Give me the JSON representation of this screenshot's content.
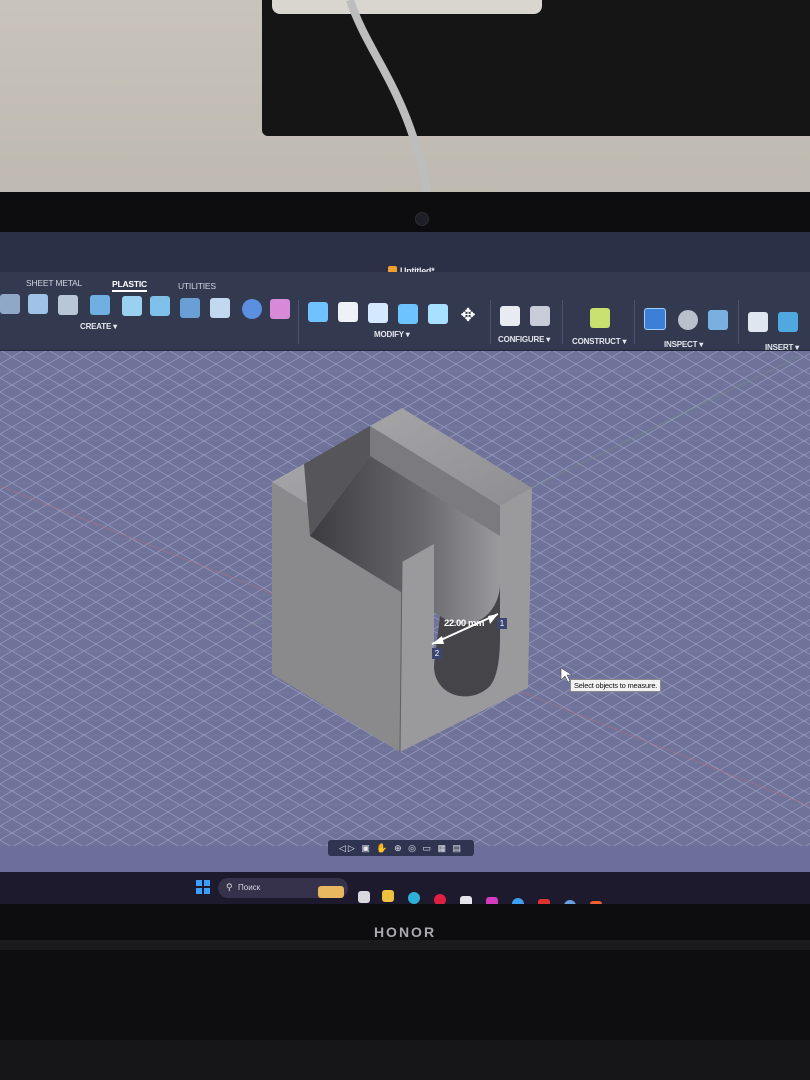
{
  "app": {
    "document_title": "Untitled*"
  },
  "tabs": [
    {
      "label": "SHEET METAL"
    },
    {
      "label": "PLASTIC"
    },
    {
      "label": "UTILITIES"
    }
  ],
  "groups": {
    "create": "CREATE ▾",
    "modify": "MODIFY ▾",
    "configure": "CONFIGURE ▾",
    "construct": "CONSTRUCT ▾",
    "inspect": "INSPECT ▾",
    "insert": "INSERT ▾"
  },
  "measurement": {
    "value": "22.00 mm",
    "point_1": "1",
    "point_2": "2",
    "tooltip": "Select objects to measure."
  },
  "navbar": {
    "icons": "◁▷ ▣ ✋ ⊕ ◎ ▭ ▦ ▤"
  },
  "taskbar": {
    "search_placeholder": "Поиск"
  },
  "device": {
    "brand": "HONOR"
  }
}
